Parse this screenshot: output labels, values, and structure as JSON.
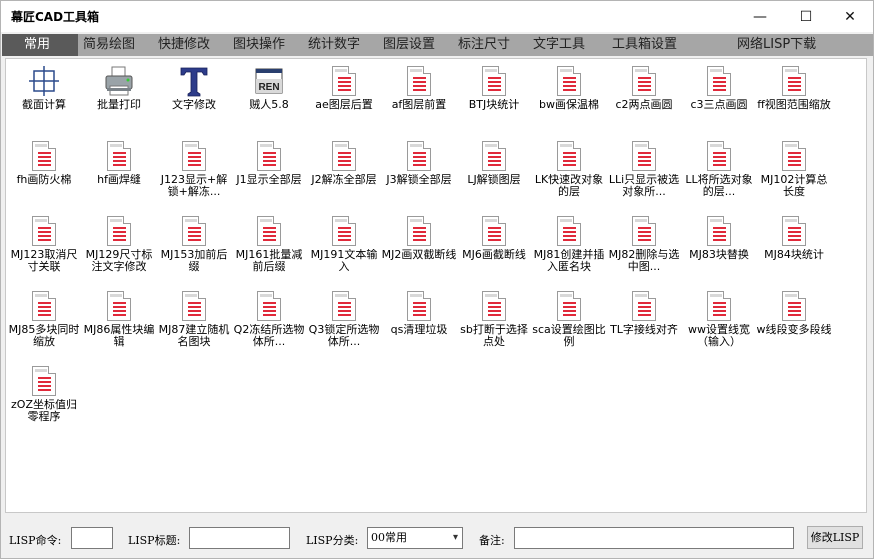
{
  "window": {
    "title": "幕匠CAD工具箱",
    "min": "—",
    "max": "☐",
    "close": "✕"
  },
  "tabs": [
    "常用",
    "简易绘图",
    "快捷修改",
    "图块操作",
    "统计数字",
    "图层设置",
    "标注尺寸",
    "文字工具",
    "工具箱设置",
    "网络LISP下载"
  ],
  "items": [
    {
      "label": "截面计算",
      "icon": "crosshair-grid-icon"
    },
    {
      "label": "批量打印",
      "icon": "printer-icon"
    },
    {
      "label": "文字修改",
      "icon": "text-t-icon"
    },
    {
      "label": "贼人5.8",
      "icon": "ren-icon",
      "icon_text": "REN"
    },
    {
      "label": "ae图层后置",
      "icon": "document-icon"
    },
    {
      "label": "af图层前置",
      "icon": "document-icon"
    },
    {
      "label": "BTJ块统计",
      "icon": "document-icon"
    },
    {
      "label": "bw画保温棉",
      "icon": "document-icon"
    },
    {
      "label": "c2两点画圆",
      "icon": "document-icon"
    },
    {
      "label": "c3三点画圆",
      "icon": "document-icon"
    },
    {
      "label": "ff视图范围缩放",
      "icon": "document-icon"
    },
    {
      "label": "fh画防火棉",
      "icon": "document-icon"
    },
    {
      "label": "hf画焊缝",
      "icon": "document-icon"
    },
    {
      "label": "J123显示+解锁+解冻...",
      "icon": "document-icon"
    },
    {
      "label": "J1显示全部层",
      "icon": "document-icon"
    },
    {
      "label": "J2解冻全部层",
      "icon": "document-icon"
    },
    {
      "label": "J3解锁全部层",
      "icon": "document-icon"
    },
    {
      "label": "LJ解锁图层",
      "icon": "document-icon"
    },
    {
      "label": "LK快速改对象的层",
      "icon": "document-icon"
    },
    {
      "label": "LLi只显示被选对象所...",
      "icon": "document-icon"
    },
    {
      "label": "LL将所选对象的层...",
      "icon": "document-icon"
    },
    {
      "label": "MJ102计算总长度",
      "icon": "document-icon"
    },
    {
      "label": "MJ123取消尺寸关联",
      "icon": "document-icon"
    },
    {
      "label": "MJ129尺寸标注文字修改",
      "icon": "document-icon"
    },
    {
      "label": "MJ153加前后缀",
      "icon": "document-icon"
    },
    {
      "label": "MJ161批量减前后缀",
      "icon": "document-icon"
    },
    {
      "label": "MJ191文本输入",
      "icon": "document-icon"
    },
    {
      "label": "MJ2画双截断线",
      "icon": "document-icon"
    },
    {
      "label": "MJ6画截断线",
      "icon": "document-icon"
    },
    {
      "label": "MJ81创建并插入匿名块",
      "icon": "document-icon"
    },
    {
      "label": "MJ82删除与选中图...",
      "icon": "document-icon"
    },
    {
      "label": "MJ83块替换",
      "icon": "document-icon"
    },
    {
      "label": "MJ84块统计",
      "icon": "document-icon"
    },
    {
      "label": "MJ85多块同时缩放",
      "icon": "document-icon"
    },
    {
      "label": "MJ86属性块编辑",
      "icon": "document-icon"
    },
    {
      "label": "MJ87建立随机名图块",
      "icon": "document-icon"
    },
    {
      "label": "Q2冻结所选物体所...",
      "icon": "document-icon"
    },
    {
      "label": "Q3锁定所选物体所...",
      "icon": "document-icon"
    },
    {
      "label": "qs清理垃圾",
      "icon": "document-icon"
    },
    {
      "label": "sb打断于选择点处",
      "icon": "document-icon"
    },
    {
      "label": "sca设置绘图比例",
      "icon": "document-icon"
    },
    {
      "label": "TL字接线对齐",
      "icon": "document-icon"
    },
    {
      "label": "ww设置线宽（输入）",
      "icon": "document-icon"
    },
    {
      "label": "w线段变多段线",
      "icon": "document-icon"
    },
    {
      "label": "zOZ坐标值归零程序",
      "icon": "document-icon"
    }
  ],
  "bottom": {
    "cmd_label": "LISP命令:",
    "cmd_value": "",
    "title_label": "LISP标题:",
    "title_value": "",
    "category_label": "LISP分类:",
    "category_value": "00常用",
    "note_label": "备注:",
    "note_value": "",
    "modify_button": "修改LISP"
  },
  "colors": {
    "tab_bar": "#a6a6a6",
    "tab_active": "#5a5a5a",
    "doc_lines": "#e0293a"
  }
}
